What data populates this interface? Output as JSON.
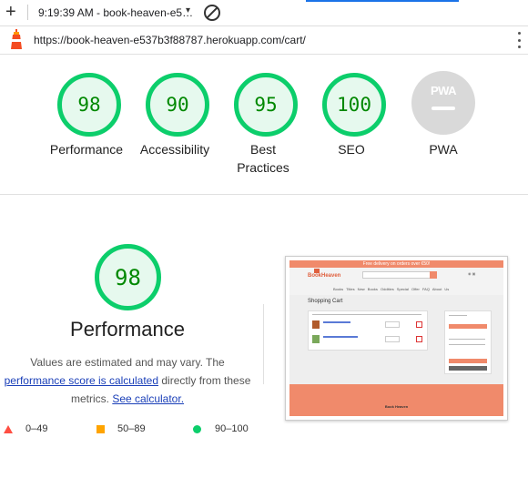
{
  "browser": {
    "new_tab_symbol": "+",
    "tab_title": "9:19:39 AM - book-heaven-e5…",
    "tab_menu_symbol": "▾",
    "address": "https://book-heaven-e537b3f88787.herokuapp.com/cart/",
    "icons": [
      "plus-icon",
      "caret-down-icon",
      "block-icon",
      "lighthouse-icon",
      "more-vert-icon"
    ]
  },
  "categories": [
    {
      "score": "98",
      "label": "Performance"
    },
    {
      "score": "90",
      "label": "Accessibility"
    },
    {
      "score": "95",
      "label": "Best\nPractices"
    },
    {
      "score": "100",
      "label": "SEO"
    },
    {
      "label": "PWA",
      "badge": "PWA"
    }
  ],
  "performance": {
    "score": "98",
    "title": "Performance",
    "desc_part1": "Values are estimated and may vary. The",
    "desc_link1": "performance score is calculated",
    "desc_part2": "directly from these metrics.",
    "desc_link2": "See calculator."
  },
  "legend": [
    {
      "range": "0–49",
      "color": "#ff4e42"
    },
    {
      "range": "50–89",
      "color": "#ffa400"
    },
    {
      "range": "90–100",
      "color": "#0cce6b"
    }
  ],
  "colors": {
    "pass": "#0cce6b",
    "pass_bg": "#e6f9ee",
    "pass_text": "#008800",
    "link": "#1a3fb8",
    "site_accent": "#f08a6b"
  },
  "thumbnail": {
    "promo": "Free delivery on orders over €50!",
    "logo": "BookHeaven",
    "nav": "Books Titles New Books Oddities Special Offer FAQ About Us",
    "cart_title": "Shopping Cart",
    "footer_title": "Book Heaven"
  }
}
